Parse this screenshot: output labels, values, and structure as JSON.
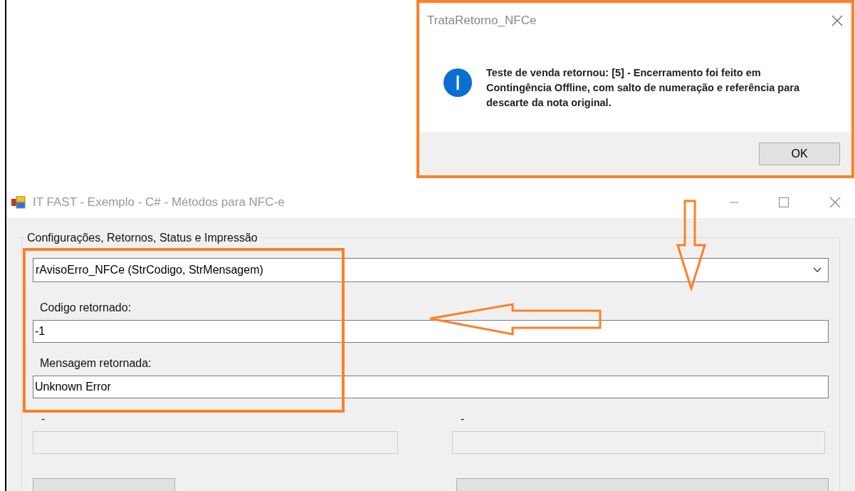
{
  "dialog": {
    "title": "TrataRetorno_NFCe",
    "message": "Teste de venda retornou: [5] - Encerramento foi feito em Contingência Offline, com salto de numeração e referência para descarte da nota original.",
    "button": "OK"
  },
  "window": {
    "title": "IT FAST - Exemplo - C# - Métodos para NFC-e"
  },
  "group": {
    "label": "Configurações, Retornos, Status e Impressão",
    "combo": "rAvisoErro_NFCe (StrCodigo, StrMensagem)",
    "fields": [
      {
        "label": "Codigo retornado:",
        "value": "-1",
        "disabled": false
      },
      {
        "label": "Mensagem retornada:",
        "value": "Unknown Error",
        "disabled": false
      },
      {
        "label": "-",
        "disabled": true
      },
      {
        "label": "-",
        "disabled": true
      }
    ]
  }
}
